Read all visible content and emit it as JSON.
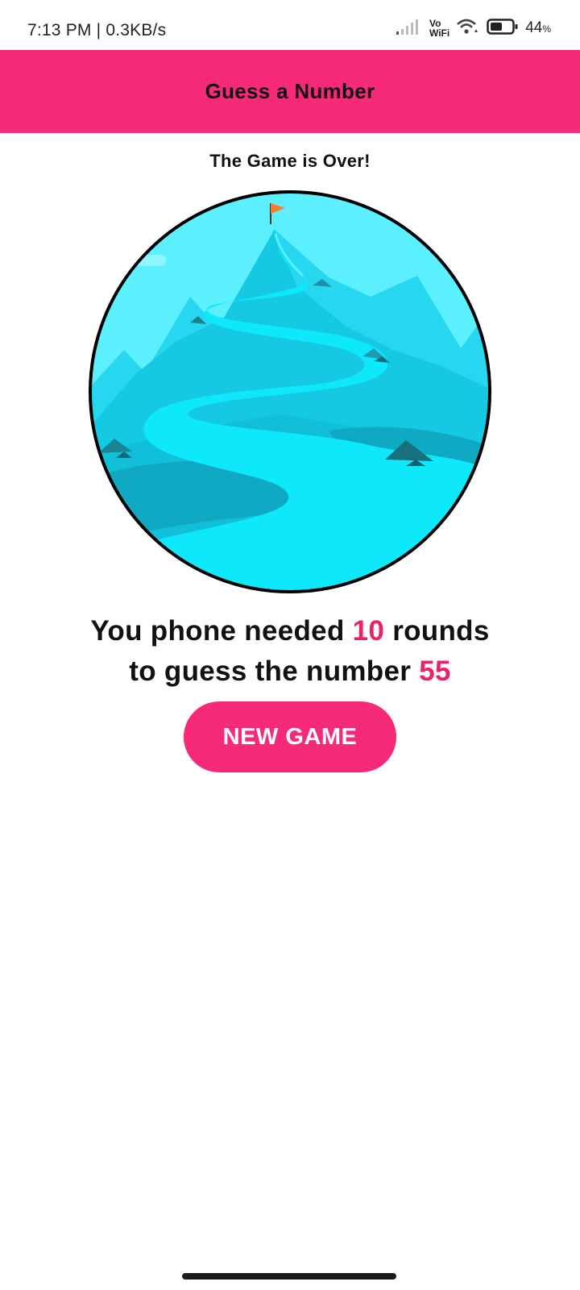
{
  "status_bar": {
    "time_speed": "7:13 PM | 0.3KB/s",
    "vo": "Vo",
    "wifi_label": "WiFi",
    "battery_percent": "44",
    "battery_unit": "%"
  },
  "header": {
    "title": "Guess a Number"
  },
  "game_over": {
    "title": "The Game is Over!",
    "line1_prefix": "You phone needed ",
    "rounds": "10",
    "line1_suffix": " rounds",
    "line2_prefix": "to guess the number ",
    "number": "55"
  },
  "actions": {
    "new_game_label": "NEW GAME"
  },
  "colors": {
    "accent": "#f72a79",
    "highlight": "#e8236c",
    "sky": "#5cf0ff",
    "river": "#0ee8fb"
  },
  "icons": [
    "signal-icon",
    "wifi-icon",
    "battery-icon",
    "flag-icon"
  ]
}
